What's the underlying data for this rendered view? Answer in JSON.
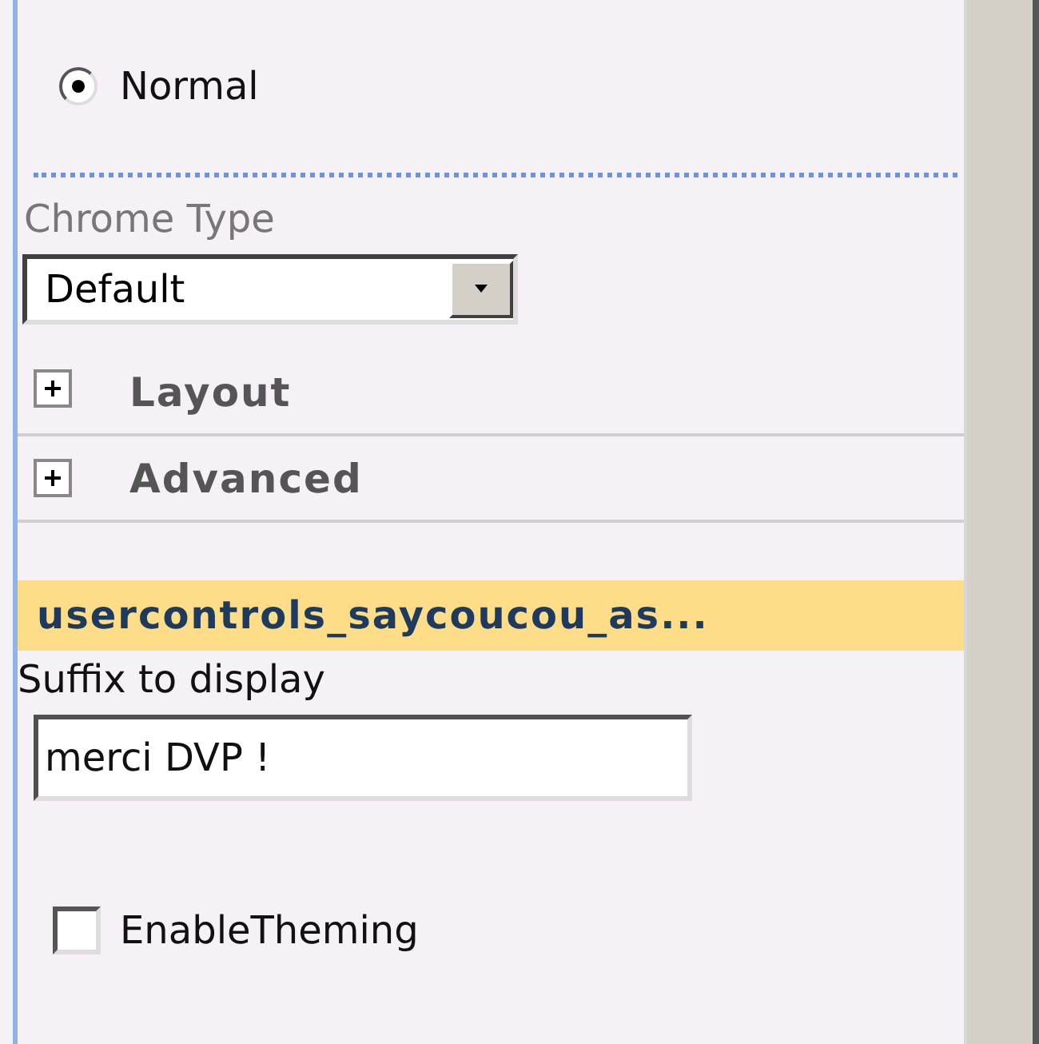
{
  "radios": [
    {
      "label": "Normal",
      "selected": true
    }
  ],
  "chrome_type": {
    "label": "Chrome Type",
    "value": "Default"
  },
  "sections": [
    {
      "label": "Layout",
      "expanded": false
    },
    {
      "label": "Advanced",
      "expanded": false
    }
  ],
  "webpart": {
    "title": "usercontrols_saycoucou_as...",
    "fields": [
      {
        "label": "Suffix to display",
        "value": "merci DVP !"
      }
    ]
  },
  "checkboxes": [
    {
      "label": "EnableTheming",
      "checked": false
    }
  ]
}
